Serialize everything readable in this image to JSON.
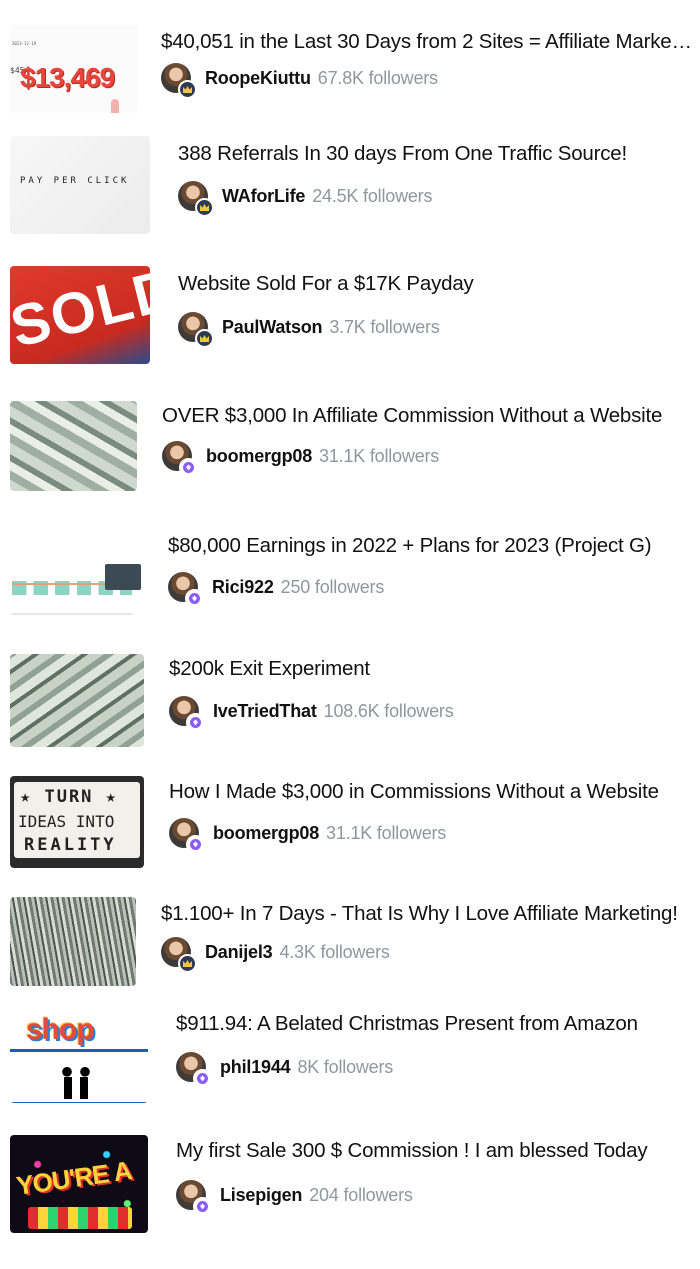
{
  "posts": [
    {
      "title": "$40,051 in the Last 30 Days from 2 Sites = Affiliate Marketi...",
      "username": "RoopeKiuttu",
      "followers": "67.8K followers",
      "badge": "crown",
      "thumb": {
        "big_number": "$13,469",
        "small_prefix": "$45",
        "date": "2023-12-19"
      }
    },
    {
      "title": "388 Referrals In 30 days From One Traffic Source!",
      "username": "WAforLife",
      "followers": "24.5K followers",
      "badge": "crown",
      "thumb": {
        "text": "PAY PER CLICK"
      }
    },
    {
      "title": "Website Sold For a $17K Payday",
      "username": "PaulWatson",
      "followers": "3.7K followers",
      "badge": "crown",
      "thumb": {
        "text": "SOLD"
      }
    },
    {
      "title": "OVER $3,000 In Affiliate Commission Without a Website",
      "username": "boomergp08",
      "followers": "31.1K followers",
      "badge": "gem",
      "thumb": {
        "kind": "cash"
      }
    },
    {
      "title": "$80,000 Earnings in 2022 + Plans for 2023 (Project G)",
      "username": "Rici922",
      "followers": "250 followers",
      "badge": "gem",
      "thumb": {
        "kind": "dashboard"
      }
    },
    {
      "title": "$200k Exit Experiment",
      "username": "IveTriedThat",
      "followers": "108.6K followers",
      "badge": "gem",
      "thumb": {
        "kind": "cash"
      }
    },
    {
      "title": "How I Made $3,000 in Commissions Without a Website",
      "username": "boomergp08",
      "followers": "31.1K followers",
      "badge": "gem",
      "thumb": {
        "line1": "★ TURN ★",
        "line2": "IDEAS INTO",
        "line3": "REALITY"
      }
    },
    {
      "title": "$1.100+ In 7 Days - That Is Why I Love Affiliate Marketing!",
      "username": "Danijel3",
      "followers": "4.3K followers",
      "badge": "crown",
      "thumb": {
        "kind": "cash-stack"
      }
    },
    {
      "title": "$911.94: A Belated Christmas Present from Amazon",
      "username": "phil1944",
      "followers": "8K followers",
      "badge": "gem",
      "thumb": {
        "text": "shop"
      }
    },
    {
      "title": "My first Sale 300 $ Commission ! I am blessed Today",
      "username": "Lisepigen",
      "followers": "204 followers",
      "badge": "gem",
      "thumb": {
        "text": "YOU'RE A"
      }
    }
  ],
  "colors": {
    "followers": "#8f979e",
    "crown_badge": "#2f3a55",
    "gem_badge": "#8b5cf6",
    "title": "#111111"
  }
}
